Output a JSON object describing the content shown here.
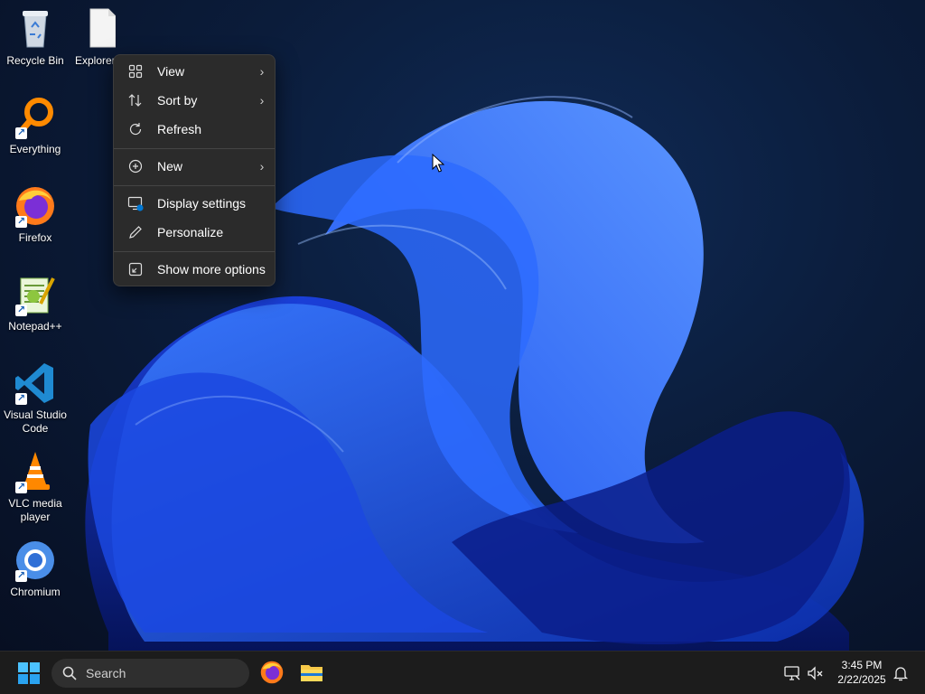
{
  "desktop_icons": [
    {
      "label": "Recycle Bin",
      "icon": "recycle-bin-icon"
    },
    {
      "label": "Explorer++",
      "icon": "file-icon"
    },
    {
      "label": "Everything",
      "icon": "everything-icon"
    },
    {
      "label": "Firefox",
      "icon": "firefox-icon"
    },
    {
      "label": "Notepad++",
      "icon": "notepad-plus-plus-icon"
    },
    {
      "label": "Visual Studio Code",
      "icon": "vscode-icon"
    },
    {
      "label": "VLC media player",
      "icon": "vlc-icon"
    },
    {
      "label": "Chromium",
      "icon": "chromium-icon"
    }
  ],
  "context_menu": {
    "items": [
      {
        "label": "View",
        "icon": "grid-icon",
        "submenu": true
      },
      {
        "label": "Sort by",
        "icon": "sort-icon",
        "submenu": true
      },
      {
        "label": "Refresh",
        "icon": "refresh-icon",
        "submenu": false
      },
      {
        "label": "New",
        "icon": "plus-circle-icon",
        "submenu": true
      },
      {
        "label": "Display settings",
        "icon": "display-settings-icon",
        "submenu": false
      },
      {
        "label": "Personalize",
        "icon": "pencil-icon",
        "submenu": false
      },
      {
        "label": "Show more options",
        "icon": "more-options-icon",
        "submenu": false
      }
    ],
    "chevron": "›"
  },
  "taskbar": {
    "search_placeholder": "Search",
    "pinned": [
      "firefox-icon",
      "file-explorer-icon"
    ],
    "clock": {
      "time": "3:45 PM",
      "date": "2/22/2025"
    }
  },
  "colors": {
    "accent": "#0078d4",
    "menu_bg": "#2b2b2b",
    "taskbar_bg": "#1c1c1c"
  }
}
